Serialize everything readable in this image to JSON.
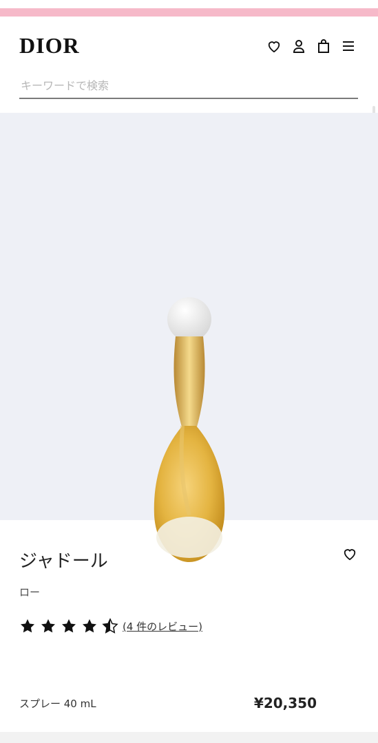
{
  "brand": {
    "logo": "DIOR"
  },
  "search": {
    "placeholder": "キーワードで検索"
  },
  "product": {
    "title": "ジャドール",
    "subtitle": "ロー",
    "rating": 4.5,
    "reviews_label": "(4 件のレビュー)",
    "size_label": "スプレー 40 mL",
    "price": "¥20,350"
  },
  "icons": [
    "heart-icon",
    "user-icon",
    "bag-icon",
    "menu-icon",
    "heart-icon"
  ],
  "colors": {
    "top_strip": "#f6b9c9",
    "hero_bg": "#eef0f6"
  }
}
